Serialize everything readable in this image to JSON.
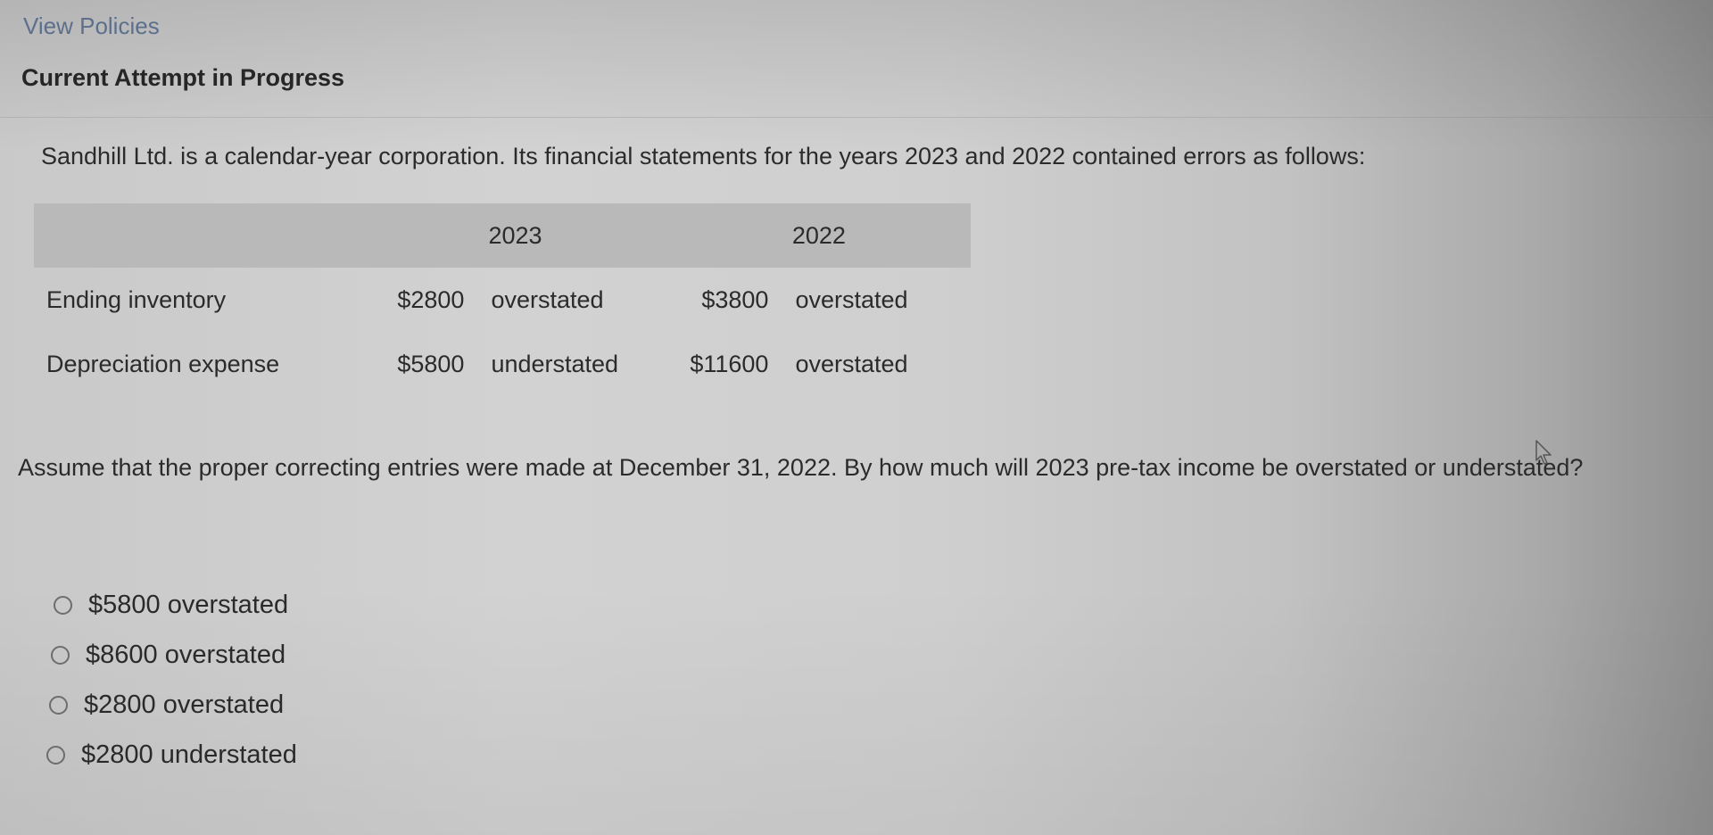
{
  "header": {
    "view_policies_link": "View Policies",
    "attempt_status": "Current Attempt in Progress"
  },
  "problem": {
    "intro": "Sandhill Ltd. is a calendar-year corporation. Its financial statements for the years 2023 and 2022 contained errors as follows:",
    "table": {
      "columns": [
        "",
        "2023",
        "2022"
      ],
      "rows": [
        {
          "label": "Ending inventory",
          "y2023_amount": "$2800",
          "y2023_direction": "overstated",
          "y2022_amount": "$3800",
          "y2022_direction": "overstated"
        },
        {
          "label": "Depreciation expense",
          "y2023_amount": "$5800",
          "y2023_direction": "understated",
          "y2022_amount": "$11600",
          "y2022_direction": "overstated"
        }
      ]
    },
    "question": "Assume that the proper correcting entries were made at December 31, 2022. By how much will 2023 pre-tax income be overstated or understated?"
  },
  "answer_options": [
    {
      "label": "$5800 overstated",
      "selected": false
    },
    {
      "label": "$8600 overstated",
      "selected": false
    },
    {
      "label": "$2800 overstated",
      "selected": false
    },
    {
      "label": "$2800 understated",
      "selected": false
    }
  ],
  "icons": {
    "radio": "radio-circle",
    "cursor": "mouse-pointer-arrow"
  },
  "colors": {
    "link": "#5c6f8c",
    "table_header_bg": "#b9b9b9",
    "text": "#2b2b2b"
  }
}
